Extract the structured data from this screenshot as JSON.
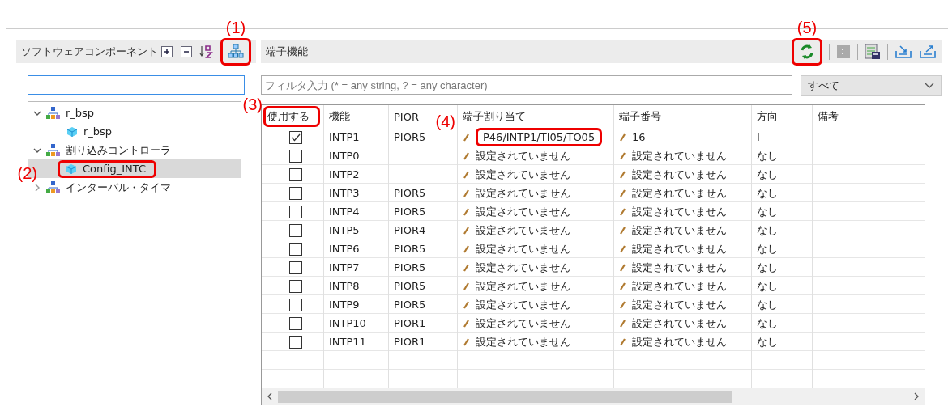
{
  "left_panel": {
    "title": "ソフトウェアコンポーネント",
    "tree": [
      {
        "label": "r_bsp",
        "expanded": true,
        "selected": false,
        "children": [
          {
            "label": "r_bsp",
            "selected": false
          }
        ]
      },
      {
        "label": "割り込みコントローラ",
        "expanded": true,
        "selected": false,
        "children": [
          {
            "label": "Config_INTC",
            "selected": true
          }
        ]
      },
      {
        "label": "インターバル・タイマ",
        "expanded": false,
        "selected": false
      }
    ]
  },
  "right_panel": {
    "title": "端子機能",
    "filter": {
      "placeholder": "フィルタ入力 (* = any string, ? = any character)"
    },
    "dropdown": {
      "value": "すべて"
    },
    "table": {
      "columns": [
        "使用する",
        "機能",
        "PIOR",
        "端子割り当て",
        "端子番号",
        "方向",
        "備考"
      ],
      "rows": [
        {
          "checked": true,
          "function": "INTP1",
          "pior": "PIOR5",
          "assignment": "P46/INTP1/TI05/TO05",
          "pin": "16",
          "direction": "I"
        },
        {
          "checked": false,
          "function": "INTP0",
          "assignment": "設定されていません",
          "pin": "設定されていません",
          "direction": "なし"
        },
        {
          "checked": false,
          "function": "INTP2",
          "assignment": "設定されていません",
          "pin": "設定されていません",
          "direction": "なし"
        },
        {
          "checked": false,
          "function": "INTP3",
          "pior": "PIOR5",
          "assignment": "設定されていません",
          "pin": "設定されていません",
          "direction": "なし"
        },
        {
          "checked": false,
          "function": "INTP4",
          "pior": "PIOR5",
          "assignment": "設定されていません",
          "pin": "設定されていません",
          "direction": "なし"
        },
        {
          "checked": false,
          "function": "INTP5",
          "pior": "PIOR4",
          "assignment": "設定されていません",
          "pin": "設定されていません",
          "direction": "なし"
        },
        {
          "checked": false,
          "function": "INTP6",
          "pior": "PIOR5",
          "assignment": "設定されていません",
          "pin": "設定されていません",
          "direction": "なし"
        },
        {
          "checked": false,
          "function": "INTP7",
          "pior": "PIOR5",
          "assignment": "設定されていません",
          "pin": "設定されていません",
          "direction": "なし"
        },
        {
          "checked": false,
          "function": "INTP8",
          "pior": "PIOR5",
          "assignment": "設定されていません",
          "pin": "設定されていません",
          "direction": "なし"
        },
        {
          "checked": false,
          "function": "INTP9",
          "pior": "PIOR5",
          "assignment": "設定されていません",
          "pin": "設定されていません",
          "direction": "なし"
        },
        {
          "checked": false,
          "function": "INTP10",
          "pior": "PIOR1",
          "assignment": "設定されていません",
          "pin": "設定されていません",
          "direction": "なし"
        },
        {
          "checked": false,
          "function": "INTP11",
          "pior": "PIOR1",
          "assignment": "設定されていません",
          "pin": "設定されていません",
          "direction": "なし"
        }
      ]
    }
  },
  "callouts": [
    {
      "label": "(1)"
    },
    {
      "label": "(2)"
    },
    {
      "label": "(3)"
    },
    {
      "label": "(4)"
    },
    {
      "label": "(5)"
    }
  ]
}
